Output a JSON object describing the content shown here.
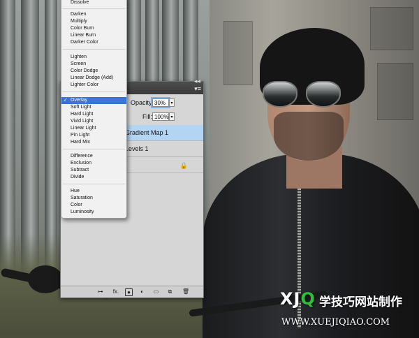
{
  "blend_menu": {
    "groups": [
      [
        "Dissolve"
      ],
      [
        "Darken",
        "Multiply",
        "Color Burn",
        "Linear Burn",
        "Darker Color"
      ],
      [
        "Lighten",
        "Screen",
        "Color Dodge",
        "Linear Dodge (Add)",
        "Lighter Color"
      ],
      [
        "Overlay",
        "Soft Light",
        "Hard Light",
        "Vivid Light",
        "Linear Light",
        "Pin Light",
        "Hard Mix"
      ],
      [
        "Difference",
        "Exclusion",
        "Subtract",
        "Divide"
      ],
      [
        "Hue",
        "Saturation",
        "Color",
        "Luminosity"
      ]
    ],
    "items": {
      "dissolve": "Dissolve",
      "darken": "Darken",
      "multiply": "Multiply",
      "color_burn": "Color Burn",
      "linear_burn": "Linear Burn",
      "darker_color": "Darker Color",
      "lighten": "Lighten",
      "screen": "Screen",
      "color_dodge": "Color Dodge",
      "linear_dodge": "Linear Dodge (Add)",
      "lighter_color": "Lighter Color",
      "overlay": "Overlay",
      "soft_light": "Soft Light",
      "hard_light": "Hard Light",
      "vivid_light": "Vivid Light",
      "linear_light": "Linear Light",
      "pin_light": "Pin Light",
      "hard_mix": "Hard Mix",
      "difference": "Difference",
      "exclusion": "Exclusion",
      "subtract": "Subtract",
      "divide": "Divide",
      "hue": "Hue",
      "saturation": "Saturation",
      "color": "Color",
      "luminosity": "Luminosity"
    },
    "selected": "Overlay",
    "check_mark": "✓",
    "highlight_color": "#3a74d6"
  },
  "layers_panel": {
    "opacity_label": "Opacity:",
    "opacity_value": "30%",
    "fill_label": "Fill:",
    "fill_value": "100%",
    "layers": [
      {
        "name": "Gradient Map 1",
        "selected": true
      },
      {
        "name": "Levels 1",
        "selected": false
      },
      {
        "name": "",
        "selected": false,
        "locked": true
      }
    ],
    "selected_color": "#b4d4f4",
    "collapse_glyph": "◂◂",
    "menu_glyph": "▾≡",
    "spin_glyph": "▾",
    "lock_glyph": "🔒",
    "bottom_tools": [
      "link-icon",
      "fx-icon",
      "mask-icon",
      "adjustment-icon",
      "group-folder-icon",
      "new-layer-icon",
      "trash-icon"
    ],
    "fx_label": "fx."
  },
  "watermark": {
    "brand_x": "X",
    "brand_j": "J",
    "brand_q": "Q",
    "brand_cn": "学技巧网站制作",
    "url": "WWW.XUEJIQIAO.COM"
  }
}
